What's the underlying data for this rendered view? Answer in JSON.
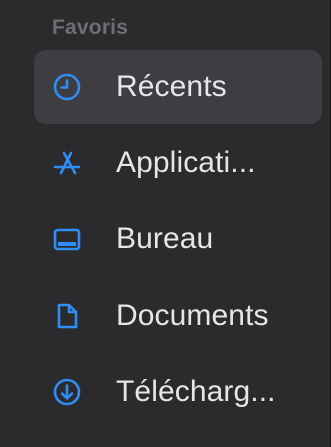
{
  "sidebar": {
    "section_title": "Favoris",
    "accent_color": "#2f8ef5",
    "items": [
      {
        "label": "Récents",
        "icon": "clock-icon",
        "selected": true
      },
      {
        "label": "Applicati...",
        "icon": "app-store-icon",
        "selected": false
      },
      {
        "label": "Bureau",
        "icon": "desktop-icon",
        "selected": false
      },
      {
        "label": "Documents",
        "icon": "document-icon",
        "selected": false
      },
      {
        "label": "Télécharg...",
        "icon": "download-icon",
        "selected": false
      }
    ]
  }
}
